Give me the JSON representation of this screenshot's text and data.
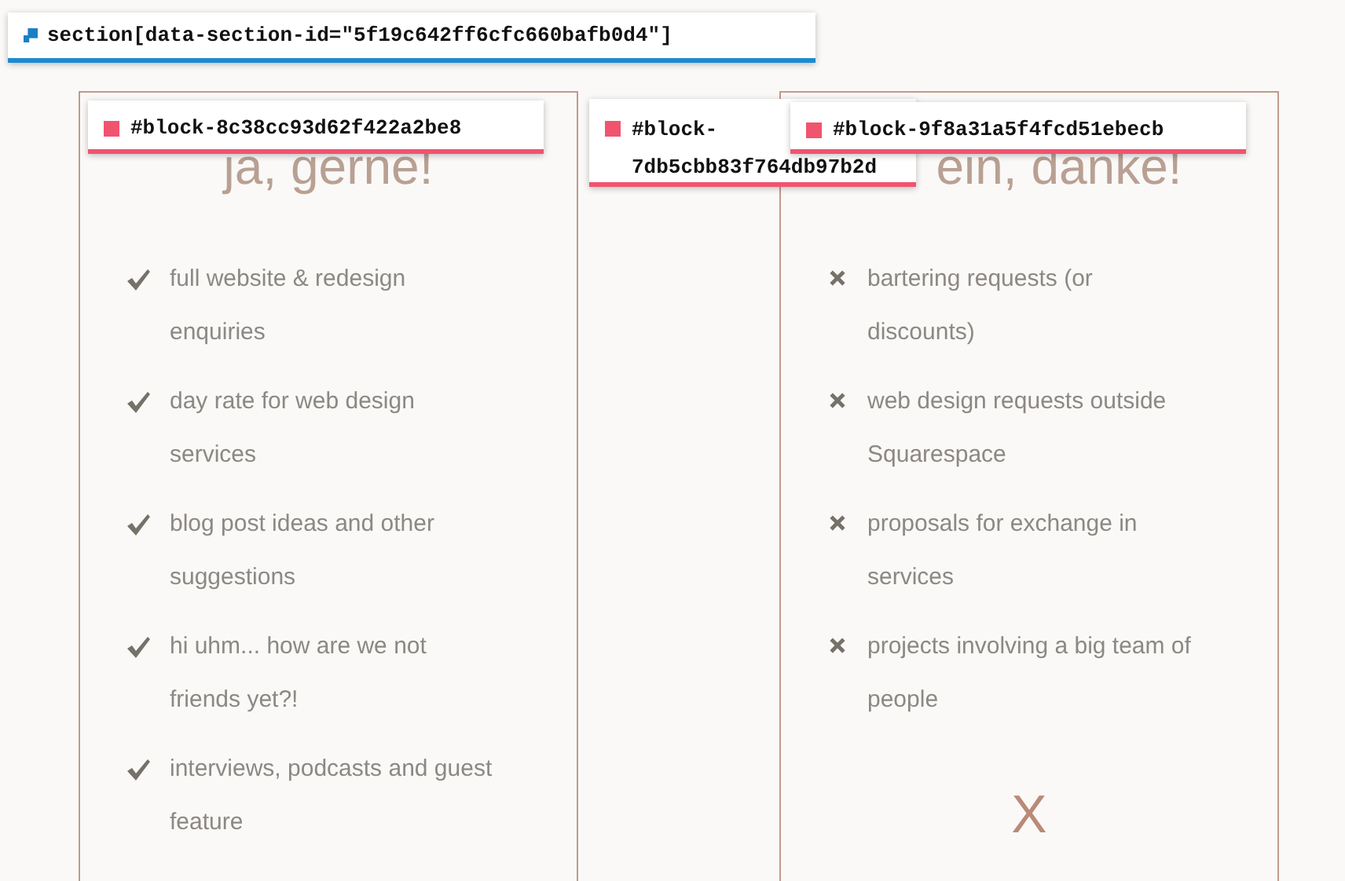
{
  "section_label": {
    "text": "section[data-section-id=\"5f19c642ff6cfc660bafb0d4\"]"
  },
  "block_labels": [
    {
      "text": "#block-8c38cc93d62f422a2be8"
    },
    {
      "lines": [
        "#block-",
        "7db5cbb83f764db97b2d"
      ]
    },
    {
      "text": "#block-9f8a31a5f4fcd51ebecb"
    }
  ],
  "columns": [
    {
      "heading": "ja, gerne!",
      "items": [
        {
          "kind": "yes",
          "text": "full website & redesign enquiries"
        },
        {
          "kind": "yes",
          "text": "day rate for web design services"
        },
        {
          "kind": "yes",
          "text": "blog post ideas and other suggestions"
        },
        {
          "kind": "yes",
          "text": "hi uhm... how are we not friends yet?!"
        },
        {
          "kind": "yes",
          "text": "interviews, podcasts and guest feature"
        }
      ]
    },
    {
      "heading": "ein, danke!",
      "items": [
        {
          "kind": "no",
          "text": "bartering requests (or discounts)"
        },
        {
          "kind": "no",
          "text": "web design requests outside Squarespace"
        },
        {
          "kind": "no",
          "text": "proposals for exchange in services"
        },
        {
          "kind": "no",
          "text": "projects involving a big team of people"
        }
      ],
      "footer_mark": "X"
    }
  ]
}
